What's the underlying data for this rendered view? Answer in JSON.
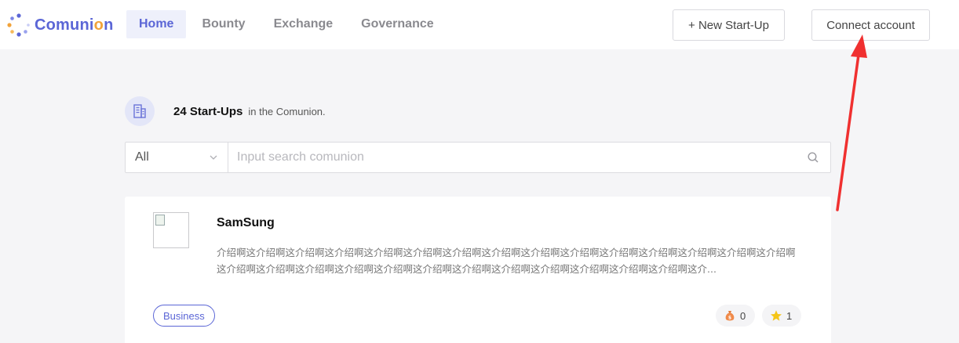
{
  "brand": {
    "name_main": "Comuni",
    "name_accent": "o",
    "name_end": "n",
    "primary_color": "#5b66d6",
    "accent_color": "#f2a33a"
  },
  "nav": {
    "items": [
      {
        "label": "Home",
        "active": true
      },
      {
        "label": "Bounty",
        "active": false
      },
      {
        "label": "Exchange",
        "active": false
      },
      {
        "label": "Governance",
        "active": false
      }
    ]
  },
  "header": {
    "new_startup_label": "+ New Start-Up",
    "connect_label": "Connect account"
  },
  "summary": {
    "count_text": "24 Start-Ups",
    "tail_text": "in the Comunion.",
    "icon": "building-icon"
  },
  "search": {
    "filter_value": "All",
    "placeholder": "Input search comunion",
    "value": ""
  },
  "startups": [
    {
      "name": "SamSung",
      "description": "介绍啊这介绍啊这介绍啊这介绍啊这介绍啊这介绍啊这介绍啊这介绍啊这介绍啊这介绍啊这介绍啊这介绍啊这介绍啊这介绍啊这介绍啊这介绍啊这介绍啊这介绍啊这介绍啊这介绍啊这介绍啊这介绍啊这介绍啊这介绍啊这介绍啊这介绍啊这介绍啊这介...",
      "tag": "Business",
      "bounty_count": "0",
      "star_count": "1"
    }
  ],
  "annotation": {
    "arrow_color": "#f03030"
  }
}
